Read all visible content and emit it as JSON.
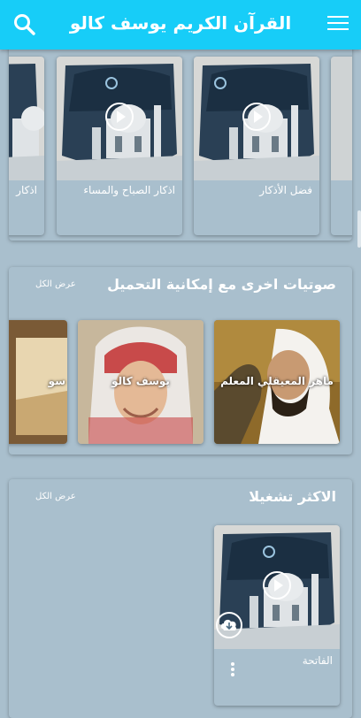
{
  "appbar": {
    "title": "القرآن الكريم يوسف كالو",
    "icons": [
      "search-icon",
      "menu-icon"
    ],
    "color": "#17cdf8"
  },
  "section1": {
    "cards": [
      {
        "label": "فضل الأذكار"
      },
      {
        "label": "اذكار الصباح والمساء"
      },
      {
        "label": "اذكار"
      }
    ]
  },
  "section2": {
    "title": "صوتيات اخرى مع إمكانية التحميل",
    "see_all": "عرض الكل",
    "reciters": [
      {
        "name": "ماهر المعيقلي  المعلم"
      },
      {
        "name": "يوسف كالو"
      },
      {
        "name": "سو"
      }
    ]
  },
  "section3": {
    "title": "الاكثر تشغيلا",
    "see_all": "عرض الكل",
    "cards": [
      {
        "label": "الفاتحة",
        "icons": [
          "play-icon",
          "download-cloud-icon",
          "more-vert-icon"
        ]
      }
    ]
  }
}
